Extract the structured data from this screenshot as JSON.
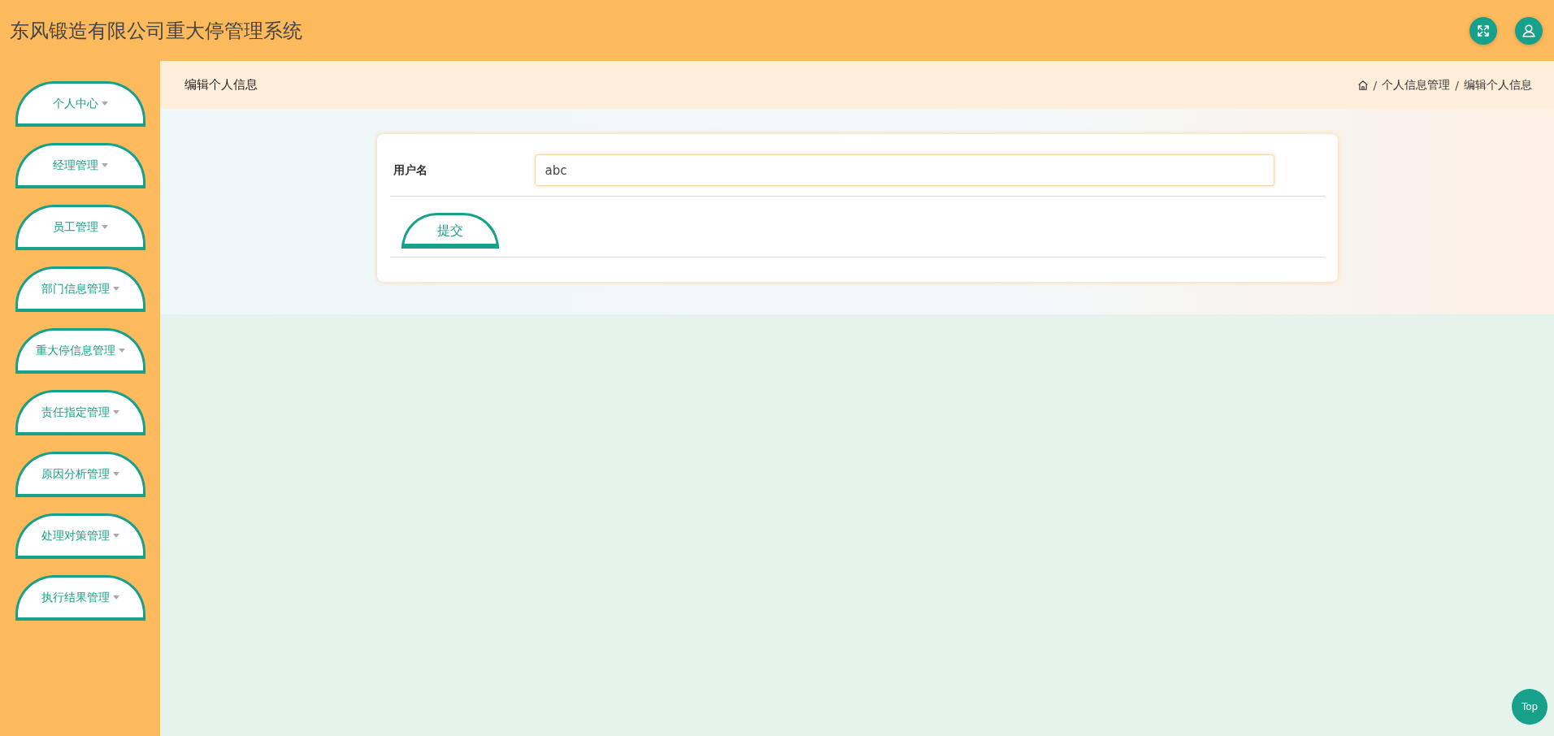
{
  "header": {
    "title": "东风锻造有限公司重大停管理系统"
  },
  "sidebar": {
    "items": [
      {
        "label": "个人中心"
      },
      {
        "label": "经理管理"
      },
      {
        "label": "员工管理"
      },
      {
        "label": "部门信息管理"
      },
      {
        "label": "重大停信息管理"
      },
      {
        "label": "责任指定管理"
      },
      {
        "label": "原因分析管理"
      },
      {
        "label": "处理对策管理"
      },
      {
        "label": "执行结果管理"
      }
    ]
  },
  "page_title": "编辑个人信息",
  "breadcrumb": [
    {
      "separator": "/",
      "label": "个人信息管理"
    },
    {
      "separator": "/",
      "label": "编辑个人信息"
    }
  ],
  "form": {
    "fields": [
      {
        "label": "用户名",
        "value": "abc"
      }
    ],
    "submit": "提交"
  },
  "top_button": "Top"
}
